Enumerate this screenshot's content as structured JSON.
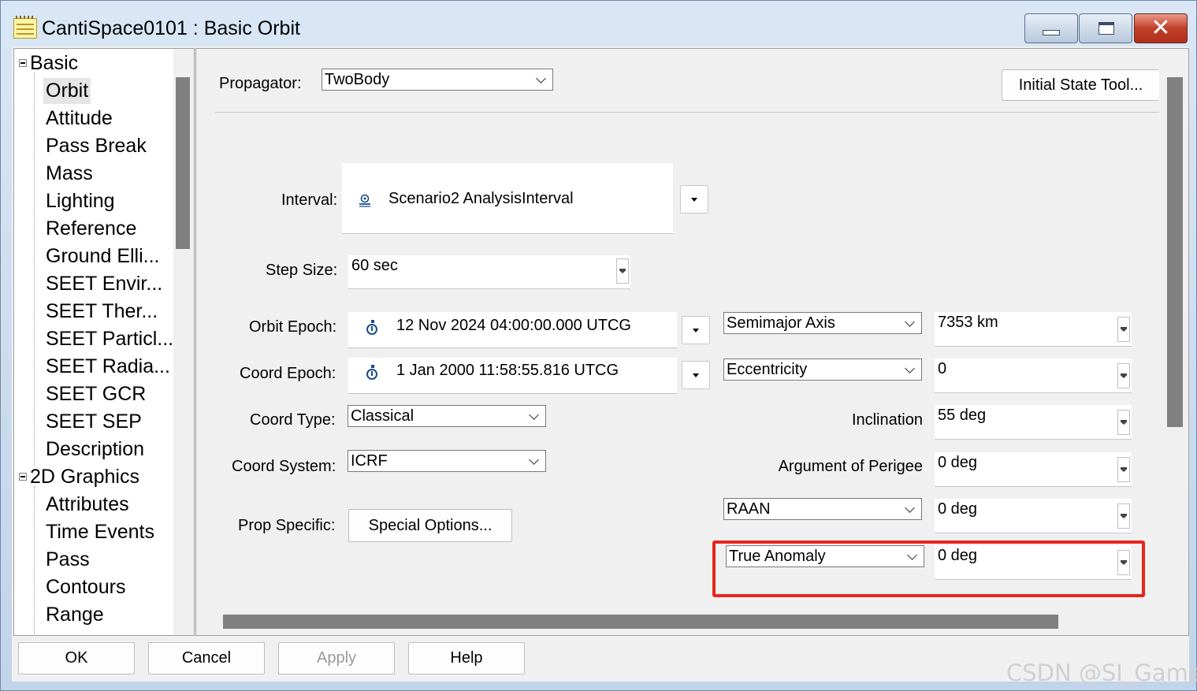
{
  "window": {
    "title": "CantiSpace0101 : Basic Orbit"
  },
  "tree": {
    "items": [
      {
        "label": "Basic",
        "level": 0,
        "expanded": true
      },
      {
        "label": "Orbit",
        "level": 1,
        "selected": true
      },
      {
        "label": "Attitude",
        "level": 1
      },
      {
        "label": "Pass Break",
        "level": 1
      },
      {
        "label": "Mass",
        "level": 1
      },
      {
        "label": "Lighting",
        "level": 1
      },
      {
        "label": "Reference",
        "level": 1
      },
      {
        "label": "Ground Elli...",
        "level": 1
      },
      {
        "label": "SEET Envir...",
        "level": 1
      },
      {
        "label": "SEET Ther...",
        "level": 1
      },
      {
        "label": "SEET Particl...",
        "level": 1
      },
      {
        "label": "SEET Radia...",
        "level": 1
      },
      {
        "label": "SEET GCR",
        "level": 1
      },
      {
        "label": "SEET SEP",
        "level": 1
      },
      {
        "label": "Description",
        "level": 1
      },
      {
        "label": "2D Graphics",
        "level": 0,
        "expanded": true
      },
      {
        "label": "Attributes",
        "level": 1
      },
      {
        "label": "Time Events",
        "level": 1
      },
      {
        "label": "Pass",
        "level": 1
      },
      {
        "label": "Contours",
        "level": 1
      },
      {
        "label": "Range",
        "level": 1
      }
    ]
  },
  "orbit": {
    "propagator_label": "Propagator:",
    "propagator_value": "TwoBody",
    "initial_state_button": "Initial State Tool...",
    "interval_label": "Interval:",
    "interval_value": "Scenario2 AnalysisInterval",
    "step_size_label": "Step Size:",
    "step_size_value": "60 sec",
    "orbit_epoch_label": "Orbit Epoch:",
    "orbit_epoch_value": "12 Nov 2024 04:00:00.000 UTCG",
    "coord_epoch_label": "Coord Epoch:",
    "coord_epoch_value": "1 Jan 2000 11:58:55.816 UTCG",
    "coord_type_label": "Coord Type:",
    "coord_type_value": "Classical",
    "coord_system_label": "Coord System:",
    "coord_system_value": "ICRF",
    "prop_specific_label": "Prop Specific:",
    "special_options_button": "Special Options...",
    "elements": {
      "semimajor_select": "Semimajor Axis",
      "semimajor_value": "7353 km",
      "eccentricity_select": "Eccentricity",
      "eccentricity_value": "0",
      "inclination_label": "Inclination",
      "inclination_value": "55 deg",
      "arg_perigee_label": "Argument of Perigee",
      "arg_perigee_value": "0 deg",
      "raan_select": "RAAN",
      "raan_value": "0 deg",
      "anomaly_select": "True Anomaly",
      "anomaly_value": "0 deg"
    }
  },
  "buttons": {
    "ok": "OK",
    "cancel": "Cancel",
    "apply": "Apply",
    "help": "Help"
  },
  "watermark": "CSDN @SI_Gamer",
  "colors": {
    "highlight": "#e8251c",
    "title_bar": "#c7d5e8",
    "close_button": "#c2402a"
  }
}
